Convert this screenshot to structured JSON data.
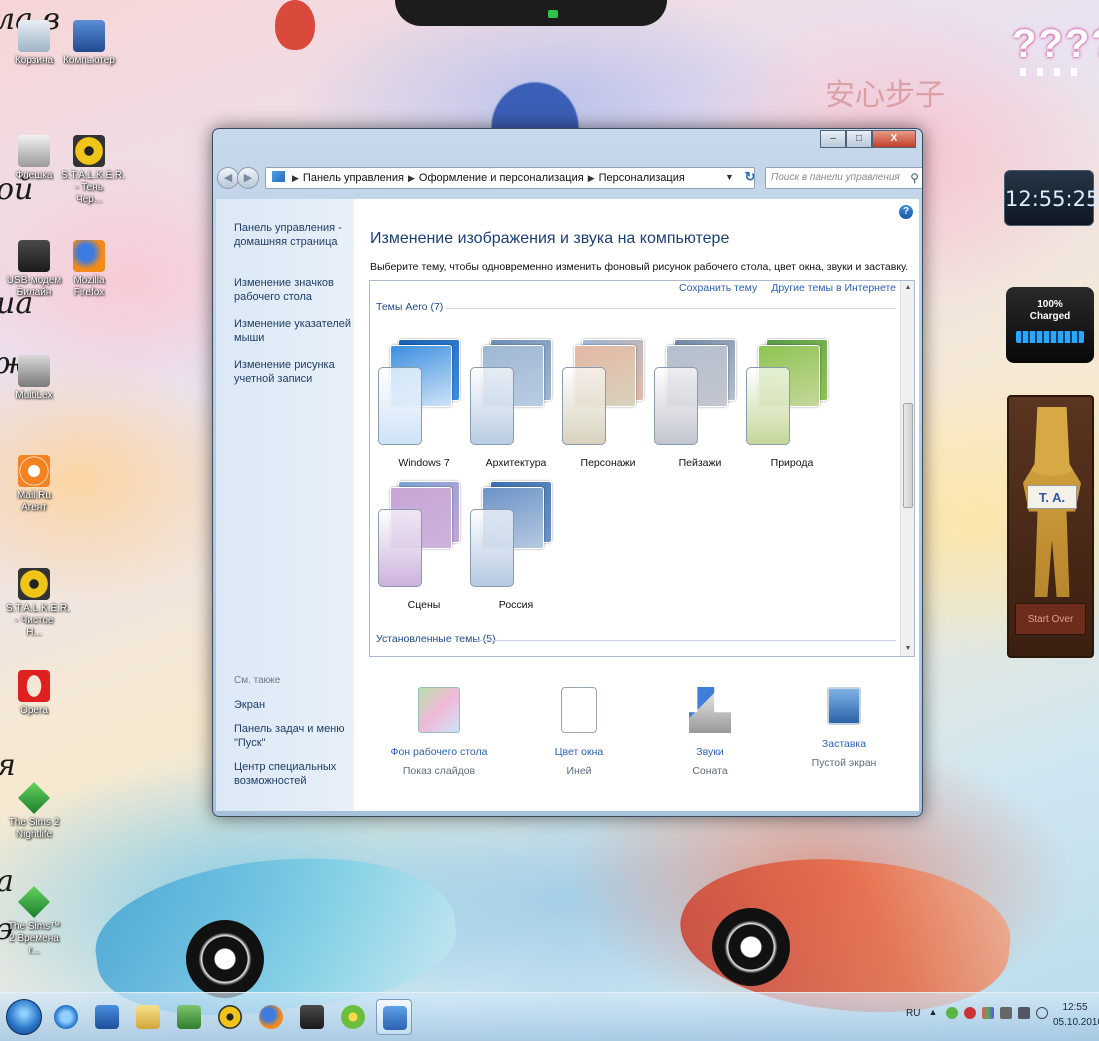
{
  "overlay_fragments": [
    "ла в",
    "ой",
    "иа",
    "жу",
    "я",
    "а",
    "э"
  ],
  "desktop_icons": [
    {
      "label": "Корзина",
      "icon": "recycle-bin-icon"
    },
    {
      "label": "Компьютер",
      "icon": "computer-icon"
    },
    {
      "label": "Флешка",
      "icon": "disk-icon"
    },
    {
      "label": "S.T.A.L.K.E.R. - Тень Чер...",
      "icon": "radiation-icon"
    },
    {
      "label": "USB-модем Билайн",
      "icon": "modem-icon"
    },
    {
      "label": "Mozilla Firefox",
      "icon": "firefox-icon"
    },
    {
      "label": "MultiLex",
      "icon": "multilex-icon"
    },
    {
      "label": "Mail.Ru Агент",
      "icon": "mail-agent-icon"
    },
    {
      "label": "S.T.A.L.K.E.R. - Чистое Н...",
      "icon": "stalker-icon"
    },
    {
      "label": "Opera",
      "icon": "opera-icon"
    },
    {
      "label": "The Sims 2 Nightlife",
      "icon": "sims-icon"
    },
    {
      "label": "The Sims™ 2 Времена г...",
      "icon": "sims-icon"
    }
  ],
  "gadgets": {
    "question": "????",
    "clock": "12:55:25",
    "battery_pct": "100%",
    "battery_status": "Charged",
    "battery_level": 1.0,
    "voodoo_tag": "T. A.",
    "voodoo_button": "Start Over"
  },
  "window": {
    "controls": {
      "minimize": "–",
      "maximize": "□",
      "close": "X"
    },
    "nav": {
      "back": "◀",
      "forward": "▶"
    },
    "breadcrumb": [
      "Панель управления",
      "Оформление и персонализация",
      "Персонализация"
    ],
    "search_placeholder": "Поиск в панели управления",
    "sidebar": {
      "home": "Панель управления - домашняя страница",
      "links": [
        "Изменение значков рабочего стола",
        "Изменение указателей мыши",
        "Изменение рисунка учетной записи"
      ],
      "see_also_title": "См. также",
      "see_also_links": [
        "Экран",
        "Панель задач и меню \"Пуск\"",
        "Центр специальных возможностей"
      ]
    },
    "main": {
      "title": "Изменение изображения и звука на компьютере",
      "description": "Выберите тему, чтобы одновременно изменить фоновый рисунок рабочего стола, цвет окна, звуки и заставку.",
      "save_theme_link": "Сохранить тему",
      "more_themes_link": "Другие темы в Интернете",
      "aero_section": "Темы Aero (7)",
      "installed_section": "Установленные темы (5)",
      "themes": [
        {
          "name": "Windows 7",
          "colors": [
            "#1a5fb4",
            "#3b8fe0",
            "#cfe3f7"
          ]
        },
        {
          "name": "Архитектура",
          "colors": [
            "#6f8fb6",
            "#9fb7d3",
            "#b9cde3"
          ]
        },
        {
          "name": "Персонажи",
          "colors": [
            "#9bb7d8",
            "#e4b8a4",
            "#d8d2bd"
          ]
        },
        {
          "name": "Пейзажи",
          "colors": [
            "#7088a8",
            "#b4bfce",
            "#c2c6cf"
          ]
        },
        {
          "name": "Природа",
          "colors": [
            "#5a9b4a",
            "#8dc452",
            "#c5d79a"
          ]
        },
        {
          "name": "Сцены",
          "colors": [
            "#7aa3d4",
            "#c7a5d6",
            "#cdb3dc"
          ]
        },
        {
          "name": "Россия",
          "colors": [
            "#3d6fb0",
            "#6b93c6",
            "#b5c9e2"
          ]
        }
      ],
      "bottom_items": [
        {
          "label": "Фон рабочего стола",
          "value": "Показ слайдов",
          "icon": "wallpaper-icon"
        },
        {
          "label": "Цвет окна",
          "value": "Иней",
          "icon": "window-color-icon"
        },
        {
          "label": "Звуки",
          "value": "Соната",
          "icon": "sounds-icon"
        },
        {
          "label": "Заставка",
          "value": "Пустой экран",
          "icon": "screensaver-icon"
        }
      ]
    }
  },
  "taskbar": {
    "apps": [
      {
        "name": "internet-explorer-icon"
      },
      {
        "name": "outlook-icon"
      },
      {
        "name": "explorer-icon"
      },
      {
        "name": "media-player-icon"
      },
      {
        "name": "stalker-icon"
      },
      {
        "name": "firefox-icon"
      },
      {
        "name": "modem-icon"
      },
      {
        "name": "icq-icon"
      },
      {
        "name": "control-panel-icon",
        "active": true
      }
    ],
    "tray_lang": "RU",
    "time": "12:55",
    "date": "05.10.2010"
  }
}
